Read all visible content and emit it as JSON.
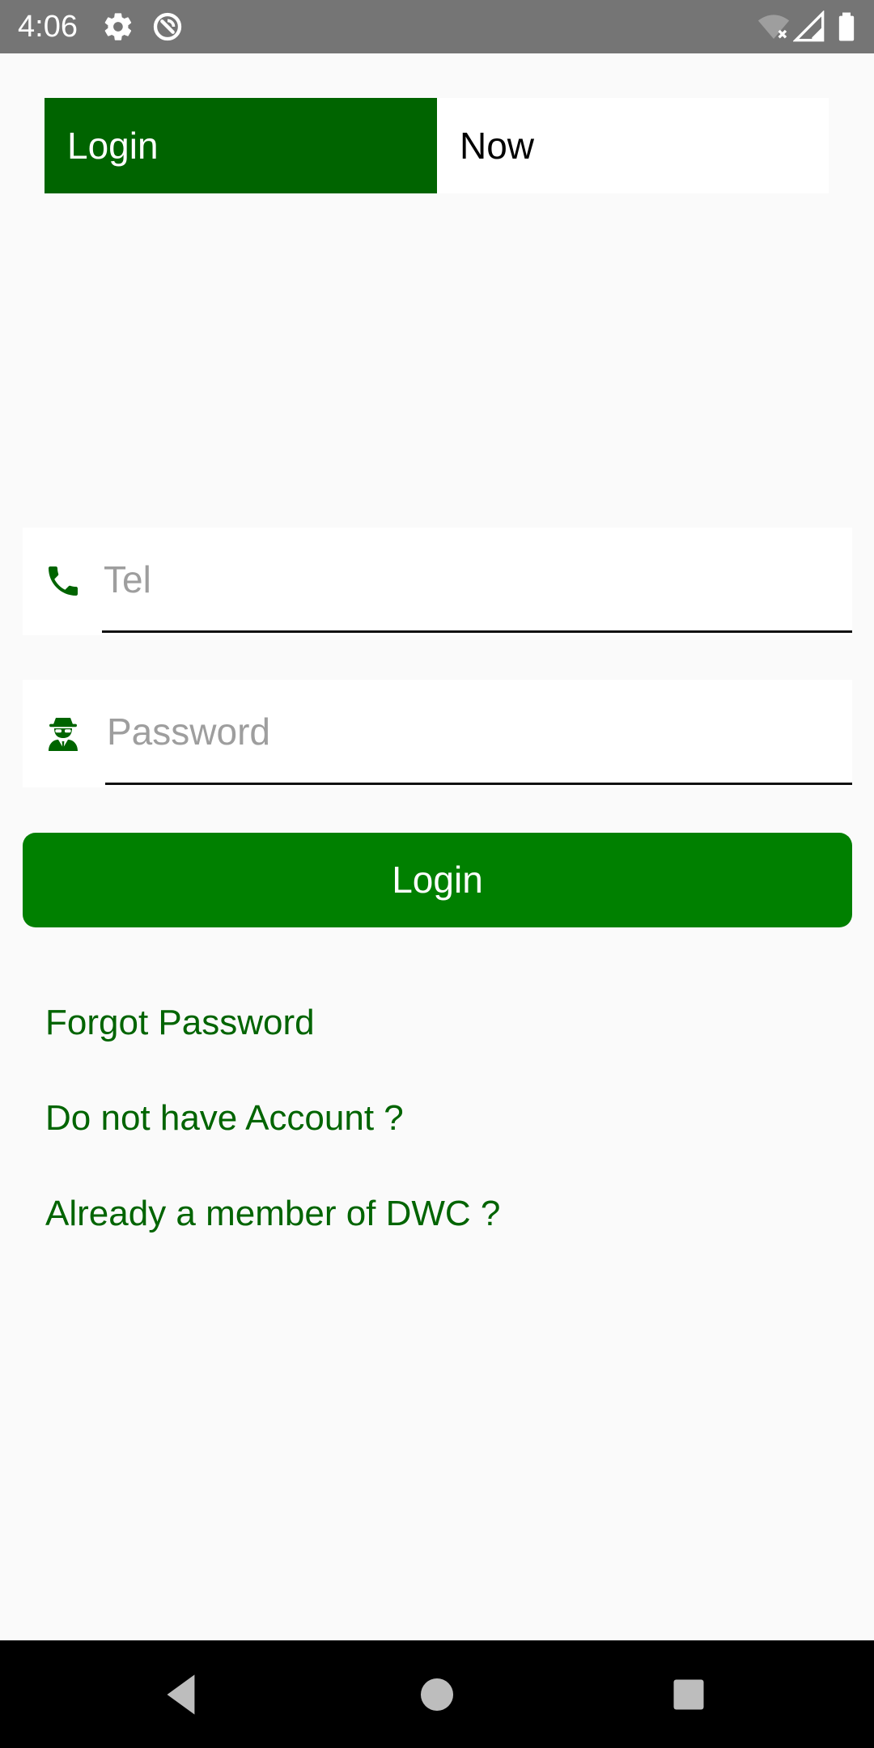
{
  "status_bar": {
    "time": "4:06",
    "icons": [
      "gear-icon",
      "sync-off-icon",
      "wifi-off-icon",
      "cellular-signal-icon",
      "battery-icon"
    ]
  },
  "header": {
    "left_label": "Login",
    "right_label": "Now"
  },
  "form": {
    "tel": {
      "icon": "phone-icon",
      "placeholder": "Tel",
      "value": ""
    },
    "password": {
      "icon": "spy-agent-icon",
      "placeholder": "Password",
      "value": ""
    },
    "login_button": "Login"
  },
  "links": {
    "forgot_password": "Forgot Password",
    "no_account": "Do not have Account ?",
    "already_member": "Already a member of DWC ?"
  },
  "nav_bar": {
    "icons": [
      "back-icon",
      "home-icon",
      "recents-icon"
    ]
  },
  "colors": {
    "primary_dark": "#006400",
    "primary_button": "#008000",
    "status_bar": "#757575",
    "background": "#fafafa",
    "nav_bar": "#000000"
  }
}
